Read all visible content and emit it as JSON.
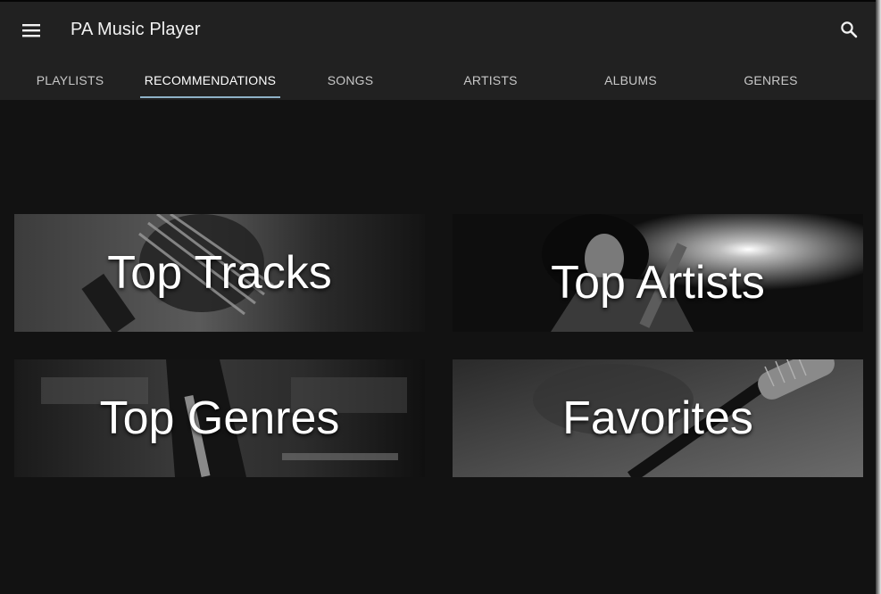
{
  "header": {
    "title": "PA Music Player",
    "menu_icon": "menu-icon",
    "search_icon": "search-icon"
  },
  "tabs": [
    {
      "label": "PLAYLISTS",
      "active": false
    },
    {
      "label": "RECOMMENDATIONS",
      "active": true
    },
    {
      "label": "SONGS",
      "active": false
    },
    {
      "label": "ARTISTS",
      "active": false
    },
    {
      "label": "ALBUMS",
      "active": false
    },
    {
      "label": "GENRES",
      "active": false
    }
  ],
  "tiles": [
    {
      "label": "Top Tracks"
    },
    {
      "label": "Top Artists"
    },
    {
      "label": "Top Genres"
    },
    {
      "label": "Favorites"
    }
  ],
  "colors": {
    "appbar": "#212121",
    "background": "#121212",
    "tab_indicator": "#8fb2c8"
  }
}
